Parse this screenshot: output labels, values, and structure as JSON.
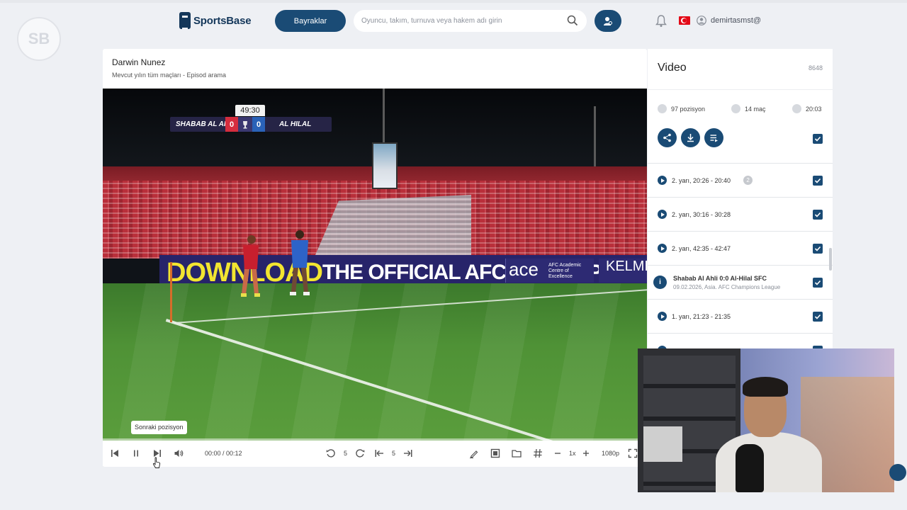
{
  "header": {
    "brand": "SportsBase",
    "watermark": "SB",
    "flags_button": "Bayraklar",
    "search_placeholder": "Oyuncu, takım, turnuva veya hakem adı girin",
    "username": "demirtasmst@"
  },
  "content": {
    "player_name": "Darwin Nunez",
    "subtitle": "Mevcut yılın tüm maçları - Episod arama"
  },
  "video": {
    "clock": "49:30",
    "home_team": "SHABAB AL AHLI",
    "away_team": "AL HILAL",
    "home_score": "0",
    "away_score": "0",
    "board_download": "DOWNLOAD",
    "board_afc": "THE OFFICIAL AFC LIVE APP",
    "board_ace": "ace",
    "board_ace_sub": "AFC Academic Centre of Excellence",
    "board_kelme": "KELME",
    "tooltip": "Sonraki pozisyon",
    "progress": 0.0
  },
  "controls": {
    "time": "00:00 / 00:12",
    "rewind_seconds": "5",
    "step_frames": "5",
    "speed": "1x",
    "quality": "1080p"
  },
  "panel": {
    "title": "Video",
    "count": "8648",
    "positions": "97 pozisyon",
    "matches": "14 maç",
    "duration": "20:03",
    "clips": [
      {
        "label": "2. yarı, 20:26 - 20:40",
        "badge": "2"
      },
      {
        "label": "2. yarı, 30:16 - 30:28"
      },
      {
        "label": "2. yarı, 42:35 - 42:47"
      },
      {
        "match_title": "Shabab Al Ahli 0:0 Al-Hilal SFC",
        "match_sub": "09.02.2026, Asia. AFC Champions League"
      },
      {
        "label": "1. yarı, 21:23 - 21:35"
      }
    ]
  },
  "colors": {
    "primary": "#1a4b75",
    "background": "#eef0f4"
  }
}
